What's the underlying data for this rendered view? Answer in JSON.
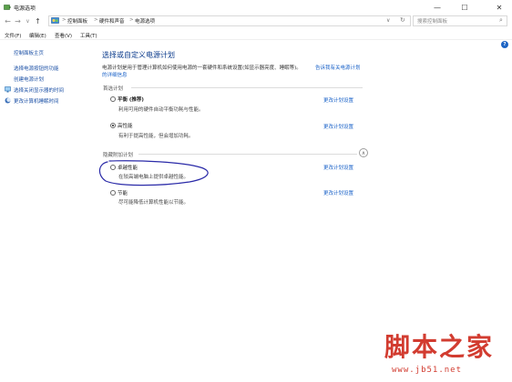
{
  "window": {
    "title": "电源选项",
    "minimize_glyph": "—",
    "maximize_glyph": "☐",
    "close_glyph": "✕"
  },
  "nav": {
    "back_glyph": "←",
    "forward_glyph": "→",
    "history_glyph": "∨",
    "up_glyph": "↑"
  },
  "address": {
    "crumbs": [
      "控制面板",
      "硬件和声音",
      "电源选项"
    ],
    "separator": ">",
    "dropdown_glyph": "∨",
    "refresh_glyph": "↻"
  },
  "search": {
    "placeholder": "搜索控制面板",
    "icon_glyph": "⌕"
  },
  "menu": {
    "items": [
      "文件(F)",
      "编辑(E)",
      "查看(V)",
      "工具(T)"
    ]
  },
  "help_glyph": "?",
  "sidebar": {
    "home": "控制面板主页",
    "links": [
      "选择电源按钮的功能",
      "创建电源计划",
      "选择关闭显示器的时间",
      "更改计算机睡眠时间"
    ]
  },
  "main": {
    "heading": "选择或自定义电源计划",
    "desc_line1": "电源计划是用于管理计算机如何使用电源的一套硬件和系统设置(如显示器亮度、睡眠等)。",
    "desc_link_1": "告诉我有关电源计划",
    "desc_link_2": "的详细信息",
    "preferred_label": "首选计划",
    "extra_label": "隐藏附加计划",
    "change_label": "更改计划设置",
    "collapse_glyph": "∧",
    "plans": [
      {
        "name": "平衡 (推荐)",
        "desc": "利用可用的硬件自动平衡功耗与性能。",
        "selected": false
      },
      {
        "name": "高性能",
        "desc": "有利于提高性能，但会增加功耗。",
        "selected": true
      },
      {
        "name": "卓越性能",
        "desc": "在较高端电脑上提供卓越性能。",
        "selected": false
      },
      {
        "name": "节能",
        "desc": "尽可能降低计算机性能以节能。",
        "selected": false
      }
    ]
  },
  "watermark": {
    "brand": "脚本之家",
    "url": "www.jb51.net"
  },
  "colors": {
    "link": "#1a62c8",
    "heading": "#0b3b8c",
    "annotation": "#2a2aa8",
    "watermark": "#d23c30"
  }
}
